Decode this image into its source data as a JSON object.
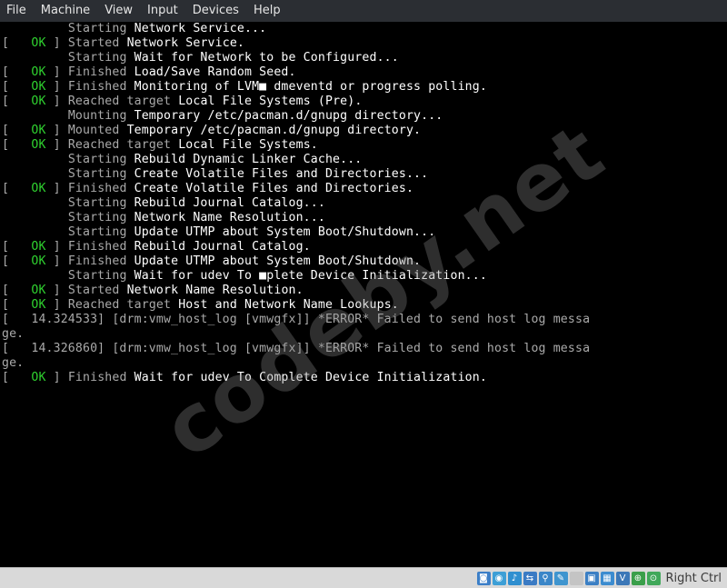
{
  "menubar": {
    "items": [
      "File",
      "Machine",
      "View",
      "Input",
      "Devices",
      "Help"
    ]
  },
  "console": {
    "lines": [
      {
        "s": "",
        "status": "",
        "a": "Starting ",
        "b": "Network Service..."
      },
      {
        "s": "[ ",
        "status": "OK",
        "a": " ] Started ",
        "b": "Network Service."
      },
      {
        "s": "",
        "status": "",
        "a": "Starting ",
        "b": "Wait for Network to be Configured..."
      },
      {
        "s": "[ ",
        "status": "OK",
        "a": " ] Finished ",
        "b": "Load/Save Random Seed."
      },
      {
        "s": "[ ",
        "status": "OK",
        "a": " ] Finished ",
        "b": "Monitoring of LVM■ dmeventd or progress polling."
      },
      {
        "s": "[ ",
        "status": "OK",
        "a": " ] Reached target ",
        "b": "Local File Systems (Pre)."
      },
      {
        "s": "",
        "status": "",
        "a": "Mounting ",
        "b": "Temporary /etc/pacman.d/gnupg directory..."
      },
      {
        "s": "[ ",
        "status": "OK",
        "a": " ] Mounted ",
        "b": "Temporary /etc/pacman.d/gnupg directory."
      },
      {
        "s": "[ ",
        "status": "OK",
        "a": " ] Reached target ",
        "b": "Local File Systems."
      },
      {
        "s": "",
        "status": "",
        "a": "Starting ",
        "b": "Rebuild Dynamic Linker Cache..."
      },
      {
        "s": "",
        "status": "",
        "a": "Starting ",
        "b": "Create Volatile Files and Directories..."
      },
      {
        "s": "[ ",
        "status": "OK",
        "a": " ] Finished ",
        "b": "Create Volatile Files and Directories."
      },
      {
        "s": "",
        "status": "",
        "a": "Starting ",
        "b": "Rebuild Journal Catalog..."
      },
      {
        "s": "",
        "status": "",
        "a": "Starting ",
        "b": "Network Name Resolution..."
      },
      {
        "s": "",
        "status": "",
        "a": "Starting ",
        "b": "Update UTMP about System Boot/Shutdown..."
      },
      {
        "s": "[ ",
        "status": "OK",
        "a": " ] Finished ",
        "b": "Rebuild Journal Catalog."
      },
      {
        "s": "[ ",
        "status": "OK",
        "a": " ] Finished ",
        "b": "Update UTMP about System Boot/Shutdown."
      },
      {
        "s": "",
        "status": "",
        "a": "Starting ",
        "b": "Wait for udev To ■plete Device Initialization..."
      },
      {
        "s": "[ ",
        "status": "OK",
        "a": " ] Started ",
        "b": "Network Name Resolution."
      },
      {
        "s": "[ ",
        "status": "OK",
        "a": " ] Reached target ",
        "b": "Host and Network Name Lookups."
      },
      {
        "s": "[   14.324533] [drm:vmw_host_log [vmwgfx]] *ERROR* Failed to send host log messa",
        "status": "",
        "a": "",
        "b": ""
      },
      {
        "s": "ge.",
        "status": "",
        "a": "",
        "b": ""
      },
      {
        "s": "[   14.326860] [drm:vmw_host_log [vmwgfx]] *ERROR* Failed to send host log messa",
        "status": "",
        "a": "",
        "b": ""
      },
      {
        "s": "ge.",
        "status": "",
        "a": "",
        "b": ""
      },
      {
        "s": "[ ",
        "status": "OK",
        "a": " ] Finished ",
        "b": "Wait for udev To Complete Device Initialization."
      }
    ]
  },
  "watermark": "codeby.net",
  "statusbar": {
    "icons": [
      {
        "name": "hard-disk-icon",
        "color": "#3c7fc8",
        "glyph": "◙"
      },
      {
        "name": "optical-drive-icon",
        "color": "#3d9fd6",
        "glyph": "◉"
      },
      {
        "name": "audio-icon",
        "color": "#2f8fd0",
        "glyph": "♪"
      },
      {
        "name": "network-icon",
        "color": "#3b7bc4",
        "glyph": "⇆"
      },
      {
        "name": "usb-icon",
        "color": "#3a86c8",
        "glyph": "⚲"
      },
      {
        "name": "shared-folders-icon",
        "color": "#3f95cf",
        "glyph": "✎"
      },
      {
        "name": "display-icon",
        "color": "#c4c4c4",
        "glyph": " "
      },
      {
        "name": "video-capture-icon",
        "color": "#3b7fc4",
        "glyph": "▣"
      },
      {
        "name": "recording-icon",
        "color": "#3c8cd0",
        "glyph": "▦"
      },
      {
        "name": "cpu-icon",
        "color": "#3c78b8",
        "glyph": "V"
      },
      {
        "name": "mouse-integration-icon",
        "color": "#3a9f4a",
        "glyph": "⊕"
      },
      {
        "name": "keyboard-capture-icon",
        "color": "#40a85a",
        "glyph": "⊙"
      }
    ],
    "host_key": "Right Ctrl"
  }
}
